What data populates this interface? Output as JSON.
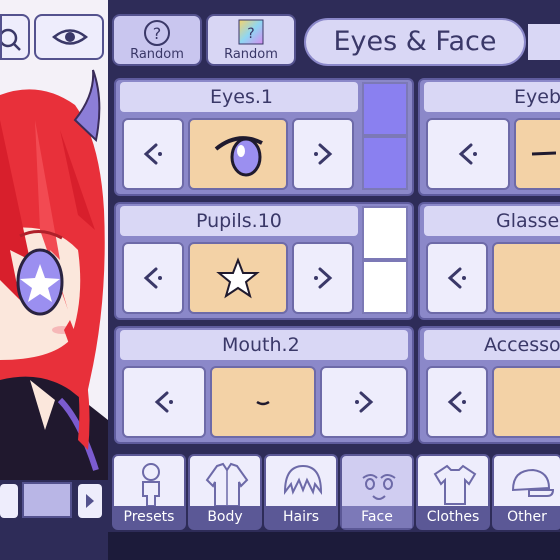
{
  "header": {
    "title": "Eyes & Face",
    "random_left_label": "Random",
    "random_right_label": "Random"
  },
  "cards": {
    "eyes": {
      "title": "Eyes.1"
    },
    "eyebrows": {
      "title": "Eyeb"
    },
    "pupils": {
      "title": "Pupils.10"
    },
    "glasses": {
      "title": "Glasse"
    },
    "mouth": {
      "title": "Mouth.2"
    },
    "accessory": {
      "title": "Accesso"
    }
  },
  "swatch_colors": {
    "eyes": [
      "#8a80f0",
      "#8a80f0"
    ],
    "pupils": [
      "#ffffff",
      "#ffffff"
    ]
  },
  "tabs": [
    {
      "label": "Presets",
      "icon": "person-outline-icon"
    },
    {
      "label": "Body",
      "icon": "jacket-icon"
    },
    {
      "label": "Hairs",
      "icon": "hair-icon"
    },
    {
      "label": "Face",
      "icon": "face-icon"
    },
    {
      "label": "Clothes",
      "icon": "shirt-icon"
    },
    {
      "label": "Other",
      "icon": "cap-icon"
    }
  ],
  "colors": {
    "panel_bg": "#2e2c58",
    "card_bg": "#8b88c9",
    "item_bg": "#f3d2a6",
    "button_bg": "#eeedfc",
    "accent_purple": "#8a80f0",
    "hair_red": "#e8303a"
  }
}
